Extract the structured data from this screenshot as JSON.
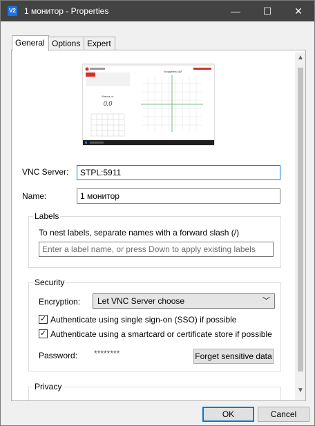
{
  "window": {
    "title": "1 монитор - Properties",
    "app_icon": "V2"
  },
  "titlebar": {
    "minimize": "—",
    "maximize": "☐",
    "close": "✕"
  },
  "tabs": [
    {
      "label": "General"
    },
    {
      "label": "Options"
    },
    {
      "label": "Expert"
    }
  ],
  "preview": {
    "header_brand": "ГРАФ-МОНИТОР",
    "mass_label": "Масса, кг",
    "mass_value": "0.0",
    "chart_title": "Координаты ЦМ"
  },
  "form": {
    "vnc_server_label": "VNC Server:",
    "vnc_server_value": "STPL:5911",
    "name_label": "Name:",
    "name_value": "1 монитор"
  },
  "labels_group": {
    "title": "Labels",
    "hint": "To nest labels, separate names with a forward slash (/)",
    "placeholder": "Enter a label name, or press Down to apply existing labels"
  },
  "security": {
    "title": "Security",
    "encryption_label": "Encryption:",
    "encryption_value": "Let VNC Server choose",
    "sso_label": "Authenticate using single sign-on (SSO) if possible",
    "smartcard_label": "Authenticate using a smartcard or certificate store if possible",
    "password_label": "Password:",
    "password_value": "********",
    "forget_button": "Forget sensitive data"
  },
  "privacy": {
    "title": "Privacy"
  },
  "buttons": {
    "ok": "OK",
    "cancel": "Cancel"
  },
  "colors": {
    "accent": "#0078d7",
    "titlebar": "#434343"
  }
}
